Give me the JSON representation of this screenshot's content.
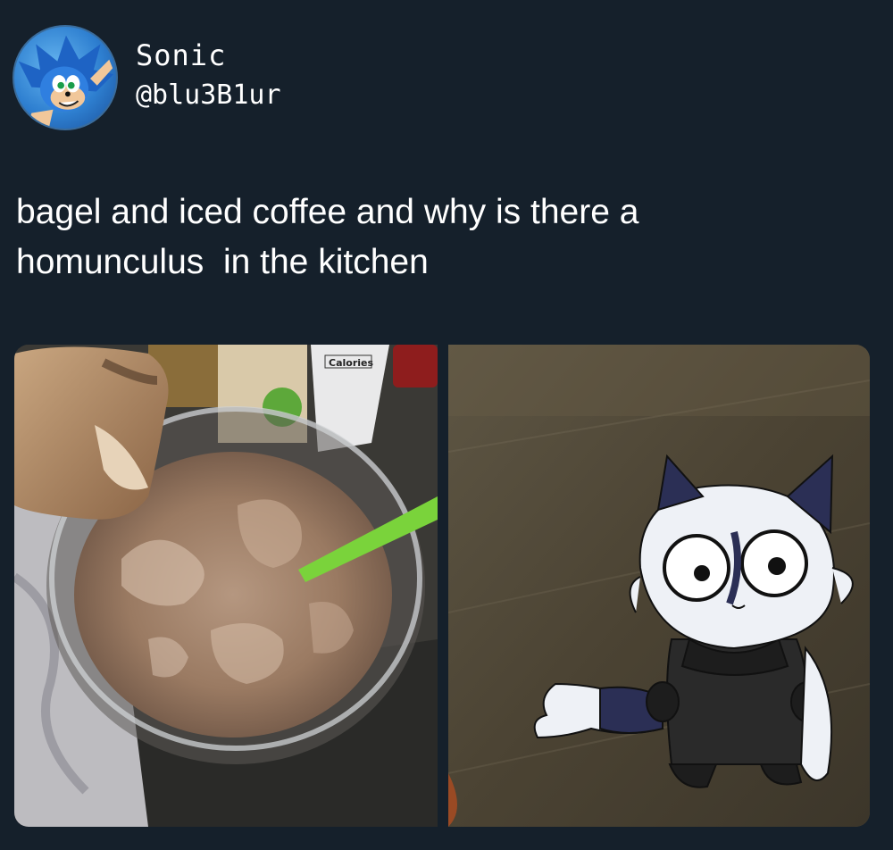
{
  "profile": {
    "display_name": "Sonic",
    "handle": "@blu3B1ur",
    "avatar_icon": "sonic-avatar"
  },
  "tweet": {
    "text": "bagel and iced coffee and why is there a\nhomunculus  in the kitchen"
  },
  "media": {
    "left_photo": {
      "label": "Calories"
    },
    "right_photo": {}
  }
}
